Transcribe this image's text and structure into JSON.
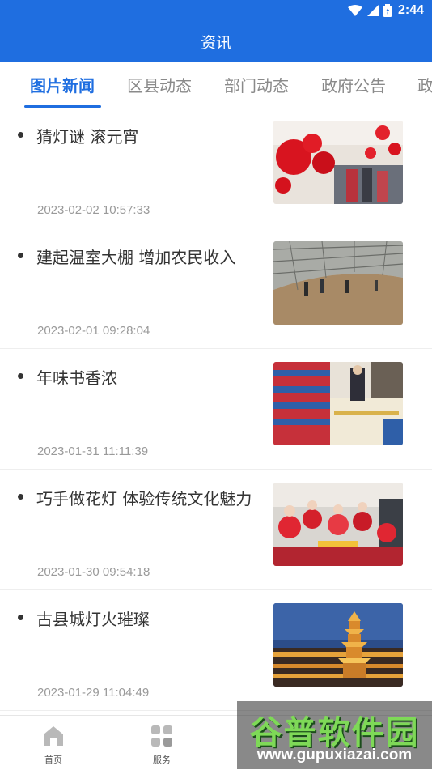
{
  "status_bar": {
    "time": "2:44",
    "icons": [
      "wifi-icon",
      "signal-icon",
      "battery-charging-icon"
    ]
  },
  "app_bar": {
    "title": "资讯"
  },
  "tabs": [
    {
      "label": "图片新闻",
      "active": true
    },
    {
      "label": "区县动态",
      "active": false
    },
    {
      "label": "部门动态",
      "active": false
    },
    {
      "label": "政府公告",
      "active": false
    },
    {
      "label": "政",
      "active": false
    }
  ],
  "news": [
    {
      "title": "猜灯谜 滚元宵",
      "date": "2023-02-02 10:57:33",
      "image": "red-lanterns-photo"
    },
    {
      "title": "建起温室大棚 增加农民收入",
      "date": "2023-02-01 09:28:04",
      "image": "greenhouse-farmers-photo"
    },
    {
      "title": "年味书香浓",
      "date": "2023-01-31 11:11:39",
      "image": "bookstore-photo"
    },
    {
      "title": "巧手做花灯 体验传统文化魅力",
      "date": "2023-01-30 09:54:18",
      "image": "children-lanterns-photo"
    },
    {
      "title": "古县城灯火璀璨",
      "date": "2023-01-29 11:04:49",
      "image": "pagoda-night-photo"
    }
  ],
  "bottom_nav": [
    {
      "label": "首页",
      "icon": "home-icon"
    },
    {
      "label": "服务",
      "icon": "grid-icon"
    }
  ],
  "watermark": {
    "title": "谷普软件园",
    "url": "www.gupuxiazai.com"
  },
  "colors": {
    "primary": "#1f6ee0",
    "text": "#333333",
    "muted": "#9a9a9a"
  }
}
